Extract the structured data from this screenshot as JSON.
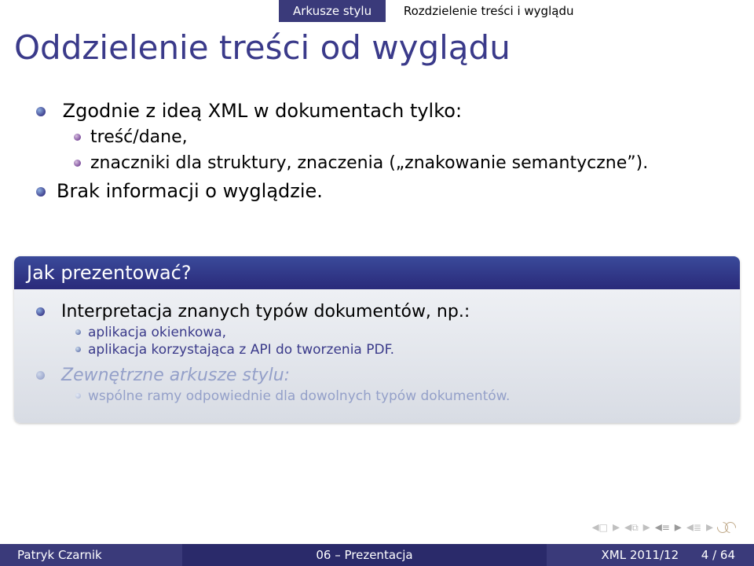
{
  "topnav": {
    "section": "Arkusze stylu",
    "subsection": "Rozdzielenie treści i wyglądu"
  },
  "title": "Oddzielenie treści od wyglądu",
  "body": {
    "lead": "Zgodnie z ideą XML w dokumentach tylko:",
    "lead_sub": [
      "treść/dane,",
      "znaczniki dla struktury, znaczenia („znakowanie semantyczne”)."
    ],
    "li2": "Brak informacji o wyglądzie."
  },
  "block": {
    "head": "Jak prezentować?",
    "l1": "Interpretacja znanych typów dokumentów, np.:",
    "l1_sub": [
      "aplikacja okienkowa,",
      "aplikacja korzystająca z API do tworzenia PDF."
    ],
    "l2": "Zewnętrzne arkusze stylu:",
    "l2_sub": [
      "wspólne ramy odpowiednie dla dowolnych typów dokumentów."
    ]
  },
  "footer": {
    "author": "Patryk Czarnik",
    "center": "06 – Prezentacja",
    "course": "XML 2011/12",
    "page": "4 / 64"
  }
}
